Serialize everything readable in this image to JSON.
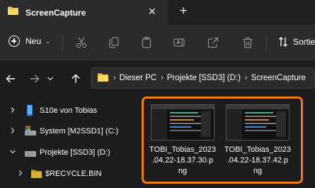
{
  "window": {
    "tab_title": "ScreenCapture",
    "close_glyph": "✕",
    "new_tab_glyph": "+"
  },
  "toolbar": {
    "new_label": "Neu",
    "new_chevron": "⌄",
    "sort_label": "Sortie",
    "icons": [
      "cut-icon",
      "copy-icon",
      "paste-icon",
      "rename-icon",
      "share-icon",
      "delete-icon",
      "sort-icon"
    ]
  },
  "address": {
    "segments": [
      "Dieser PC",
      "Projekte [SSD3] (D:)",
      "ScreenCapture"
    ],
    "separator": "›"
  },
  "sidebar": {
    "items": [
      {
        "label": "S10e von Tobias",
        "icon": "phone-icon",
        "expanded": false
      },
      {
        "label": "System [M2SSD1] (C:)",
        "icon": "system-drive-icon",
        "expanded": false
      },
      {
        "label": "Projekte [SSD3] (D:)",
        "icon": "drive-icon",
        "expanded": true
      },
      {
        "label": "$RECYCLE.BIN",
        "icon": "folder-icon",
        "expanded": false
      }
    ]
  },
  "files": [
    {
      "name_lines": [
        "TOBI_Tobias_2023",
        ".04.22-18.37.30.p",
        "ng"
      ]
    },
    {
      "name_lines": [
        "TOBI_Tobias_2023",
        ".04.22-18.37.42.p",
        "ng"
      ]
    }
  ],
  "colors": {
    "accent_orange": "#f07c0e",
    "folder_yellow": "#f4c542",
    "background": "#1c1c1c",
    "toolbar": "#2b2b2b"
  }
}
